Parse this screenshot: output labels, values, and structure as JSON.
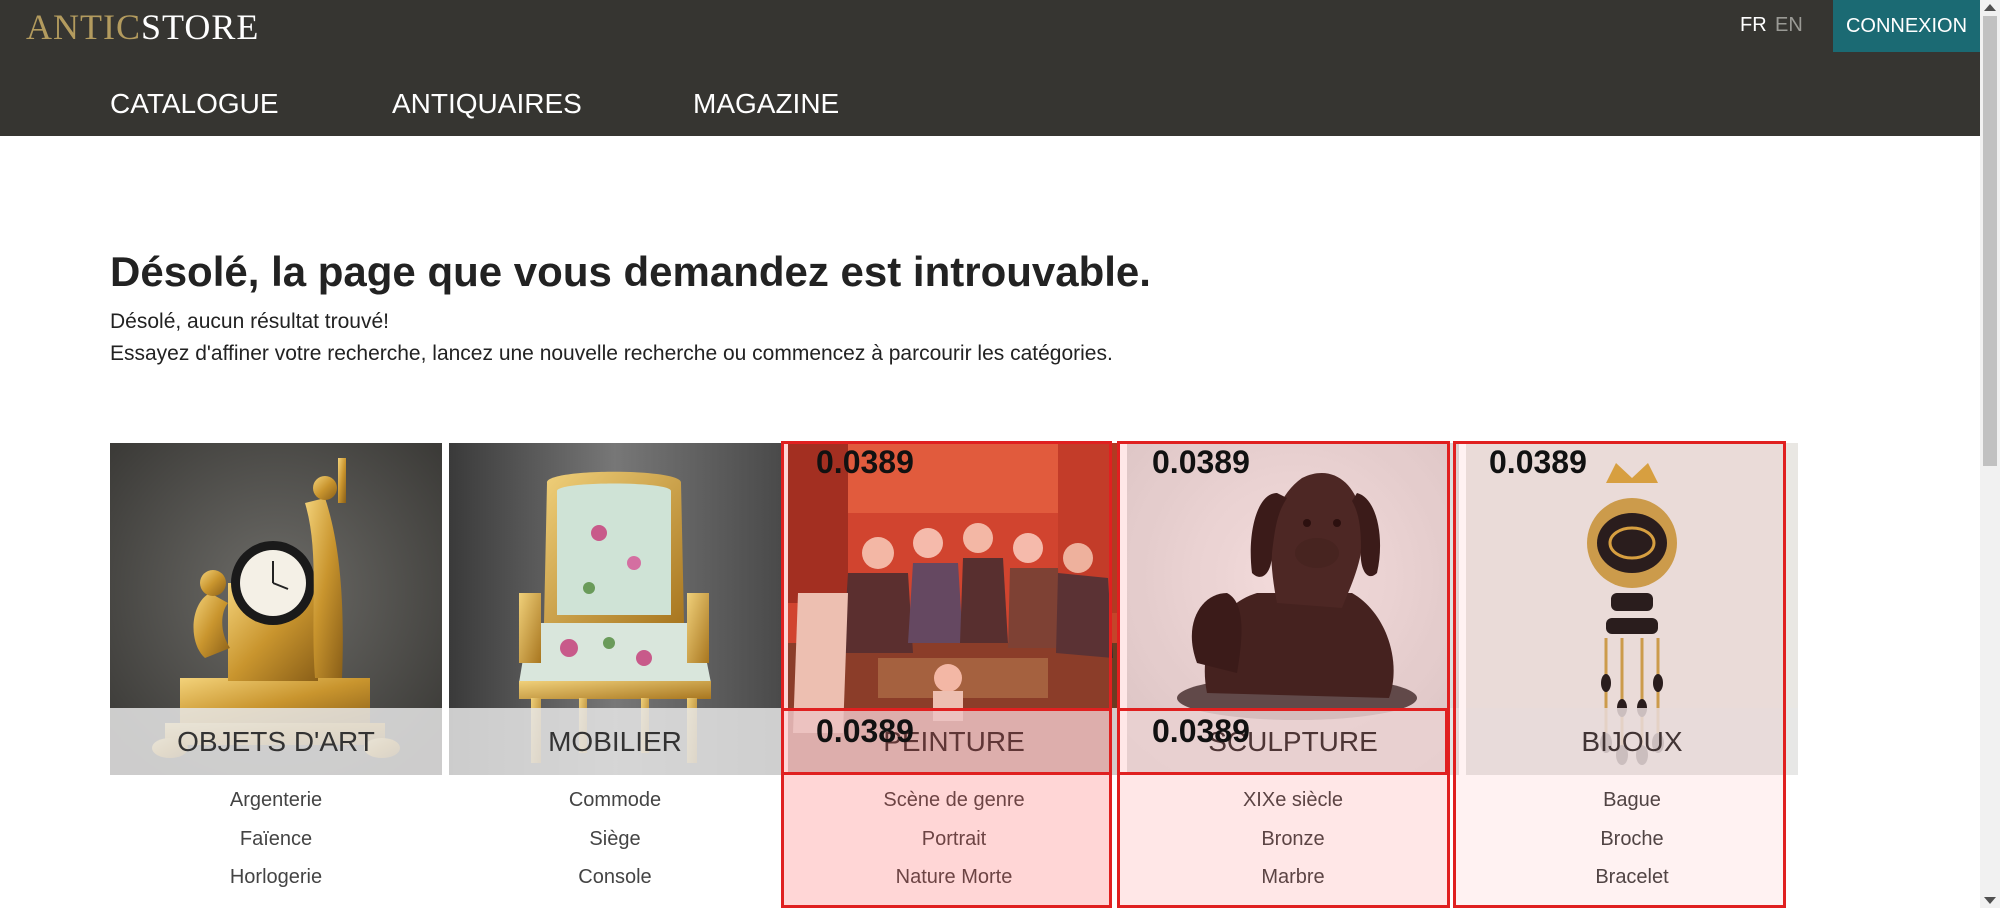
{
  "header": {
    "logo_part1": "ANTIC",
    "logo_part2": "STORE",
    "lang_fr": "FR",
    "lang_en": "EN",
    "connexion": "CONNEXION",
    "nav": [
      "CATALOGUE",
      "ANTIQUAIRES",
      "MAGAZINE"
    ]
  },
  "main": {
    "title": "Désolé, la page que vous demandez est introuvable.",
    "message1": "Désolé, aucun résultat trouvé!",
    "message2": "Essayez d'affiner votre recherche, lancez une nouvelle recherche ou commencez à parcourir les catégories."
  },
  "categories": [
    {
      "label": "OBJETS D'ART",
      "subs": [
        "Argenterie",
        "Faïence",
        "Horlogerie"
      ]
    },
    {
      "label": "MOBILIER",
      "subs": [
        "Commode",
        "Siège",
        "Console"
      ]
    },
    {
      "label": "PEINTURE",
      "subs": [
        "Scène de genre",
        "Portrait",
        "Nature Morte"
      ]
    },
    {
      "label": "SCULPTURE",
      "subs": [
        "XIXe siècle",
        "Bronze",
        "Marbre"
      ]
    },
    {
      "label": "BIJOUX",
      "subs": [
        "Bague",
        "Broche",
        "Bracelet"
      ]
    }
  ],
  "overlay_scores": [
    "0.0389",
    "0.0389",
    "0.0389",
    "0.0389",
    "0.0389"
  ],
  "colors": {
    "header_bg": "#363531",
    "logo_gold": "#b39b5e",
    "connexion_bg": "#1b6a73",
    "highlight": "#e02020"
  }
}
